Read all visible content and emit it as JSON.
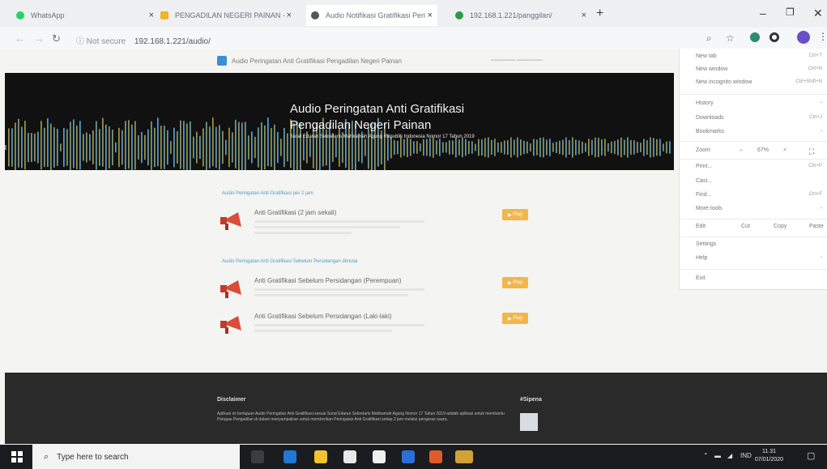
{
  "browser": {
    "tabs": [
      {
        "label": "WhatsApp",
        "color": "#25d366"
      },
      {
        "label": "PENGADILAN NEGERI PAINAN -",
        "color": "#f0b429"
      },
      {
        "label": "Audio Notifikasi Gratifikasi Peri",
        "color": "#555555"
      },
      {
        "label": "192.168.1.221/panggilan/",
        "color": "#2a9d4a"
      }
    ],
    "new_tab_symbol": "+",
    "url_security": "Not secure",
    "url": "192.168.1.221/audio/"
  },
  "site": {
    "header_title": "Audio Peringatan Anti Gratifikasi Pengadilan Negeri Painan",
    "banner": {
      "title_line1": "Audio Peringatan Anti Gratifikasi",
      "title_line2": "Pengadilan Negeri Painan",
      "subtitle": "Surat Edaran Sekretaris Mahkamah Agung Republik Indonesia Nomor 17 Tahun 2019"
    },
    "sections": [
      {
        "heading": "Audio Peringatan Anti Gratifikasi per 2 jam",
        "items": [
          {
            "title": "Anti Gratifikasi (2 jam sekali)",
            "button": "Play"
          }
        ]
      },
      {
        "heading": "Audio Peringatan Anti Gratifikasi Sebelum Persidangan dimulai",
        "items": [
          {
            "title": "Anti Gratifikasi Sebelum Persidangan (Perempuan)",
            "button": "Play"
          },
          {
            "title": "Anti Gratifikasi Sebelum Persidangan (Laki-laki)",
            "button": "Play"
          }
        ]
      }
    ],
    "footer": {
      "disclaimer_heading": "Disclaimer",
      "disclaimer_text": "Aplikasi ini bertujuan Audio Peringatan Anti Gratifikasi sesuai Surat Edaran Sekretaris Mahkamah Agung Nomor 17 Tahun 2019 adalah aplikasi untuk membantu Petugas Pengadilan di dalam menyampaikan untuk memberikan Peringatan Anti Gratifikasi setiap 2 jam melalui pengeras suara.",
      "side_heading": "#Sipena"
    }
  },
  "menu": {
    "items": [
      {
        "label": "New tab",
        "shortcut": "Ctrl+T"
      },
      {
        "label": "New window",
        "shortcut": "Ctrl+N"
      },
      {
        "label": "New incognito window",
        "shortcut": "Ctrl+Shift+N"
      },
      {
        "label": "History",
        "shortcut": ""
      },
      {
        "label": "Downloads",
        "shortcut": "Ctrl+J"
      },
      {
        "label": "Bookmarks",
        "shortcut": ""
      },
      {
        "label": "Zoom",
        "shortcut": ""
      },
      {
        "label": "Print...",
        "shortcut": "Ctrl+P"
      },
      {
        "label": "Cast...",
        "shortcut": ""
      },
      {
        "label": "Find...",
        "shortcut": "Ctrl+F"
      },
      {
        "label": "More tools",
        "shortcut": ""
      },
      {
        "label": "Edit",
        "shortcut": ""
      },
      {
        "label": "Settings",
        "shortcut": ""
      },
      {
        "label": "Help",
        "shortcut": ""
      },
      {
        "label": "Exit",
        "shortcut": ""
      }
    ],
    "zoom_value": "67%",
    "zoom_minus": "–",
    "zoom_plus": "+",
    "edit_cut": "Cut",
    "edit_copy": "Copy",
    "edit_paste": "Paste"
  },
  "taskbar": {
    "search_placeholder": "Type here to search",
    "language": "IND",
    "time": "11.31",
    "date": "07/01/2020"
  }
}
